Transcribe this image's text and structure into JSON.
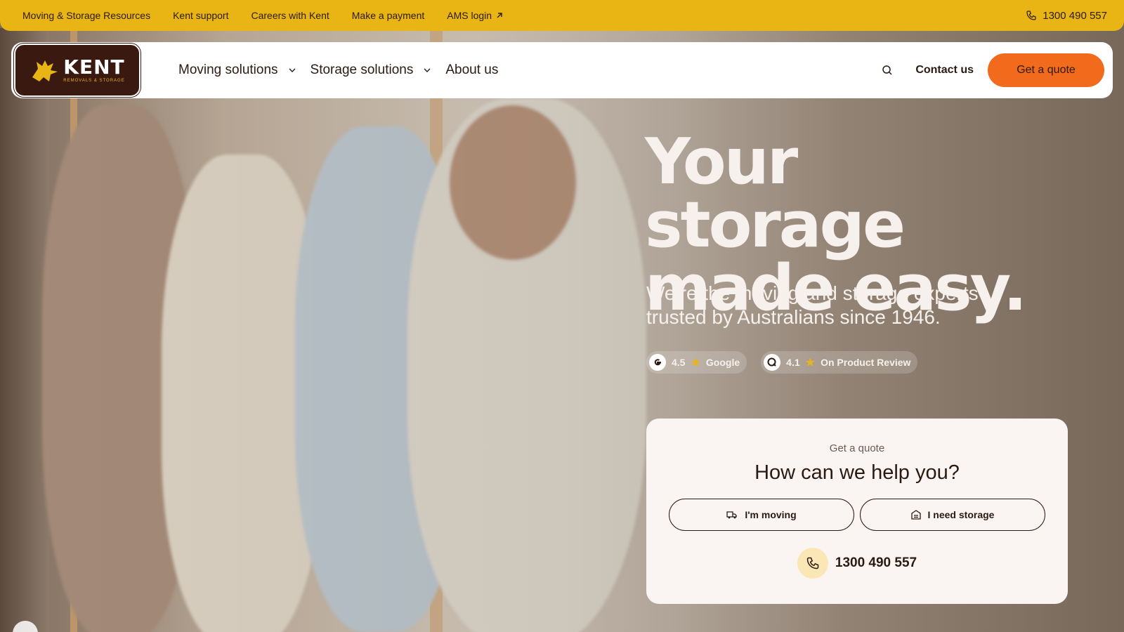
{
  "topbar": {
    "links": [
      {
        "label": "Moving & Storage Resources"
      },
      {
        "label": "Kent support"
      },
      {
        "label": "Careers with Kent"
      },
      {
        "label": "Make a payment"
      },
      {
        "label": "AMS login",
        "icon": "external-arrow-icon"
      }
    ],
    "phone": "1300 490 557",
    "bg_color": "#e8b514"
  },
  "logo": {
    "name": "KENT",
    "tagline": "REMOVALS & STORAGE"
  },
  "nav": {
    "items": [
      {
        "label": "Moving solutions",
        "has_dropdown": true
      },
      {
        "label": "Storage solutions",
        "has_dropdown": true
      },
      {
        "label": "About us",
        "has_dropdown": false
      }
    ],
    "contact_label": "Contact us",
    "quote_label": "Get a quote",
    "quote_color": "#f26a1b"
  },
  "hero": {
    "headline_line1": "Your storage",
    "headline_line2": "made easy.",
    "subline": "We’re the moving and storage experts trusted by Australians since 1946.",
    "ratings": [
      {
        "icon": "google-icon",
        "score": "4.5",
        "source": "Google"
      },
      {
        "icon": "product-review-icon",
        "score": "4.1",
        "source": "On Product Review"
      }
    ]
  },
  "quote_card": {
    "eyebrow": "Get a quote",
    "title": "How can we help you?",
    "options": [
      {
        "label": "I'm moving",
        "icon": "truck-icon"
      },
      {
        "label": "I need storage",
        "icon": "storage-icon"
      }
    ],
    "phone": "1300 490 557"
  }
}
